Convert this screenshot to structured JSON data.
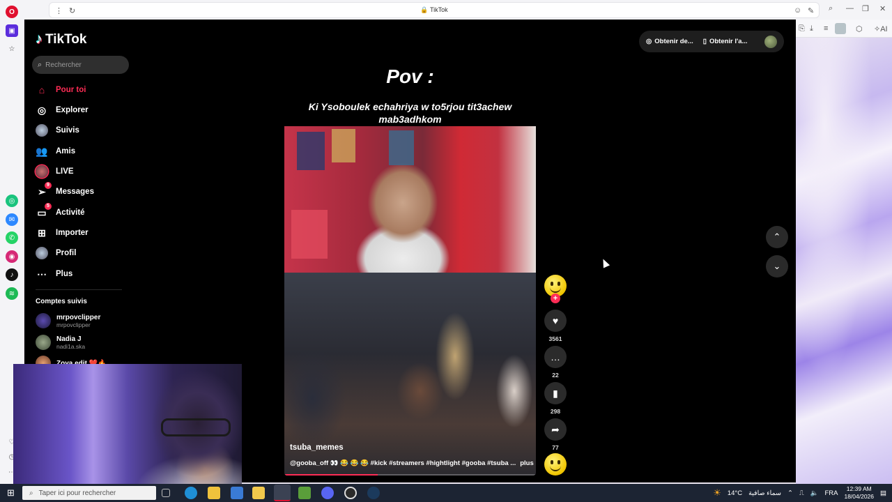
{
  "browser": {
    "tab_title": "TikTok"
  },
  "sidebar": {
    "search_placeholder": "Rechercher",
    "nav": [
      {
        "label": "Pour toi",
        "icon": "home-icon",
        "active": true
      },
      {
        "label": "Explorer",
        "icon": "compass-icon"
      },
      {
        "label": "Suivis",
        "icon": "following-icon"
      },
      {
        "label": "Amis",
        "icon": "friends-icon"
      },
      {
        "label": "LIVE",
        "icon": "live-icon"
      },
      {
        "label": "Messages",
        "icon": "messages-icon",
        "badge": "9"
      },
      {
        "label": "Activité",
        "icon": "activity-icon",
        "badge": "5"
      },
      {
        "label": "Importer",
        "icon": "upload-icon"
      },
      {
        "label": "Profil",
        "icon": "profile-icon"
      },
      {
        "label": "Plus",
        "icon": "more-icon"
      }
    ],
    "followed_title": "Comptes suivis",
    "followed": [
      {
        "name": "mrpovclipper",
        "handle": "mrpovclipper"
      },
      {
        "name": "Nadia J",
        "handle": "nadi1a.ska"
      },
      {
        "name": "Zoya edit ❤️🔥",
        "handle": ""
      }
    ]
  },
  "header": {
    "get_coins": "Obtenir de...",
    "get_app": "Obtenir l'a..."
  },
  "video": {
    "overlay_title": "Pov :",
    "overlay_caption": "Ki Ysoboulek echahriya w to5rjou tit3achew mab3adhkom",
    "author": "tsuba_memes",
    "description": "@gooba_off 👀 😂 😂 😂 #kick #streamers #hightlight #gooba #tsuba ...",
    "more": "plus",
    "progress": 0.37
  },
  "actions": {
    "likes": "3561",
    "comments": "22",
    "saves": "298",
    "shares": "77"
  },
  "taskbar": {
    "search_placeholder": "Taper ici pour rechercher",
    "temperature": "14°C",
    "weather": "سماء صافية",
    "language": "FRA",
    "time": "12:39 AM",
    "date": "18/04/2026"
  },
  "colors": {
    "tiktok_red": "#fe2c55",
    "tiktok_cyan": "#25f4ee",
    "page_bg": "#000000"
  }
}
